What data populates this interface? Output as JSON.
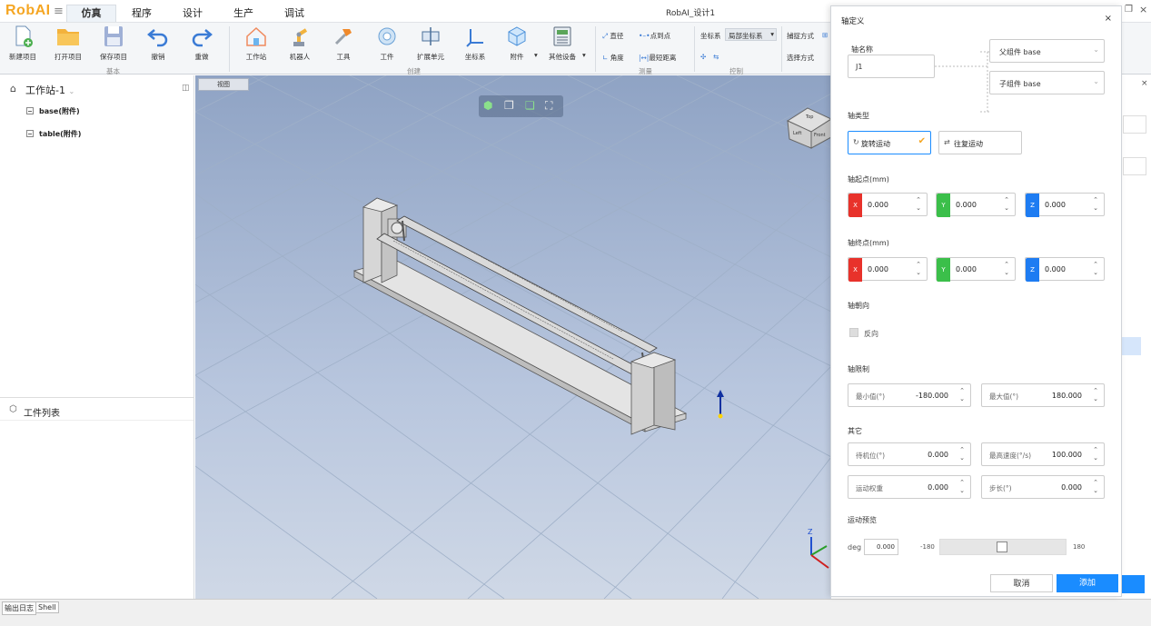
{
  "app": {
    "logo": "RobAI",
    "title": "RobAI_设计1"
  },
  "menu_tabs": [
    "仿真",
    "程序",
    "设计",
    "生产",
    "调试"
  ],
  "ribbon": {
    "basic": {
      "items": [
        "新建项目",
        "打开项目",
        "保存项目",
        "撤销",
        "重做"
      ],
      "group": "基本"
    },
    "create": {
      "items": [
        "工作站",
        "机器人",
        "工具",
        "工件",
        "扩展单元",
        "坐标系",
        "附件",
        "其他设备"
      ],
      "group": "创建"
    },
    "measure": {
      "items": [
        "直径",
        "点到点",
        "角度",
        "最短距离"
      ],
      "group": "测量"
    },
    "control": {
      "coord_label": "坐标系",
      "coord_value": "局部坐标系",
      "group": "控制"
    },
    "capture": {
      "capture_label": "捕捉方式",
      "select_label": "选择方式"
    }
  },
  "left_panel": {
    "station": "工作站-1",
    "tree": [
      "base(附件)",
      "table(附件)"
    ],
    "parts_title": "工件列表"
  },
  "viewport": {
    "tab": "视图",
    "cube_labels": {
      "top": "Top",
      "left": "Left",
      "front": "Front"
    }
  },
  "bottom_tabs": [
    "输出日志",
    "Shell"
  ],
  "dialog": {
    "title": "轴定义",
    "axis_name_label": "轴名称",
    "axis_name_value": "J1",
    "parent": "父组件 base",
    "child": "子组件 base",
    "axis_type_label": "轴类型",
    "rotary": "旋转运动",
    "linear": "往复运动",
    "start_label": "轴起点(mm)",
    "start": {
      "x": "0.000",
      "y": "0.000",
      "z": "0.000"
    },
    "end_label": "轴终点(mm)",
    "end": {
      "x": "0.000",
      "y": "0.000",
      "z": "0.000"
    },
    "axis_letters": {
      "x": "X",
      "y": "Y",
      "z": "Z"
    },
    "direction_label": "轴朝向",
    "reverse": "反向",
    "limit_label": "轴限制",
    "min_label": "最小值(°)",
    "min_value": "-180.000",
    "max_label": "最大值(°)",
    "max_value": "180.000",
    "other_label": "其它",
    "home_label": "待机位(°)",
    "home_value": "0.000",
    "speed_label": "最高速度(°/s)",
    "speed_value": "100.000",
    "weight_label": "运动权重",
    "weight_value": "0.000",
    "step_label": "步长(°)",
    "step_value": "0.000",
    "preview_label": "运动预览",
    "deg_label": "deg",
    "deg_value": "0.000",
    "slider_min": "-180",
    "slider_max": "180",
    "slider_position": 0.5,
    "cancel": "取消",
    "add": "添加"
  },
  "colors": {
    "accent": "#1a8cff",
    "x_axis": "#e8322b",
    "y_axis": "#3bbf4a",
    "z_axis": "#1e7cf2",
    "logo": "#f5a623"
  }
}
